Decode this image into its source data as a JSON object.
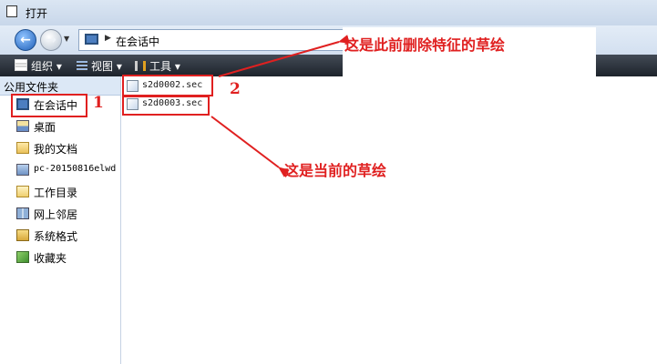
{
  "window": {
    "title": "打开"
  },
  "address": {
    "location": "在会话中"
  },
  "toolbar": {
    "organize": "组织",
    "views": "视图",
    "tools": "工具"
  },
  "sidebar": {
    "header": "公用文件夹",
    "items": [
      {
        "label": "在会话中",
        "icon": "monitor-icon"
      },
      {
        "label": "桌面",
        "icon": "desktop-icon"
      },
      {
        "label": "我的文档",
        "icon": "documents-folder-icon"
      },
      {
        "label": "pc-20150816elwd",
        "icon": "computer-icon"
      },
      {
        "label": "工作目录",
        "icon": "working-folder-icon"
      },
      {
        "label": "网上邻居",
        "icon": "network-icon"
      },
      {
        "label": "系统格式",
        "icon": "system-folder-icon"
      },
      {
        "label": "收藏夹",
        "icon": "favorites-icon"
      }
    ]
  },
  "files": [
    {
      "name": "s2d0002.sec",
      "icon": "sketch-file-icon"
    },
    {
      "name": "s2d0003.sec",
      "icon": "sketch-file-icon"
    }
  ],
  "annotations": {
    "label_1": "1",
    "label_2": "2",
    "note_deleted": "这是此前删除特征的草绘",
    "note_current": "这是当前的草绘",
    "color": "#e02020"
  }
}
